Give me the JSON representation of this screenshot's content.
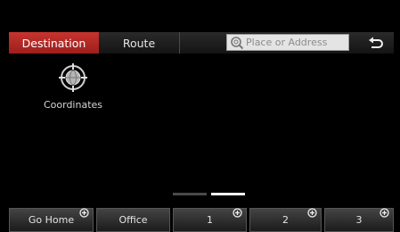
{
  "tabs": {
    "destination": "Destination",
    "route": "Route"
  },
  "search": {
    "placeholder": "Place or Address"
  },
  "main": {
    "coordinates_label": "Coordinates"
  },
  "pager": {
    "pages": 2,
    "active_page": 2
  },
  "bottom_buttons": {
    "go_home": "Go Home",
    "office": "Office",
    "slot1": "1",
    "slot2": "2",
    "slot3": "3"
  },
  "colors": {
    "accent_red": "#b3292a",
    "background": "#000000"
  },
  "icons": {
    "search": "magnifier-icon",
    "back": "back-arrow-icon",
    "coordinates": "crosshair-globe-icon",
    "add": "plus-circle-icon"
  }
}
